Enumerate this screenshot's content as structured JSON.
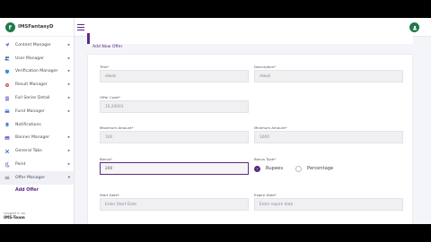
{
  "brand": {
    "name": "IMSFantasyD"
  },
  "sidebar": {
    "items": [
      {
        "label": "Content Manager",
        "icon": "paper-plane-icon",
        "arrow": "▸"
      },
      {
        "label": "User Manager",
        "icon": "users-icon",
        "arrow": "▸"
      },
      {
        "label": "Verification Manager",
        "icon": "shield-icon",
        "arrow": "▸"
      },
      {
        "label": "Result Manager",
        "icon": "gear-icon",
        "arrow": "▸"
      },
      {
        "label": "Full Series Detail",
        "icon": "document-icon",
        "arrow": "▸"
      },
      {
        "label": "Fund Manager",
        "icon": "card-icon",
        "arrow": "▸"
      },
      {
        "label": "Notifications",
        "icon": "bell-icon",
        "arrow": ""
      },
      {
        "label": "Banner Manager",
        "icon": "image-icon",
        "arrow": "▸"
      },
      {
        "label": "General Tabs",
        "icon": "cross-icon",
        "arrow": "▸"
      },
      {
        "label": "Point",
        "icon": "moon-icon",
        "arrow": "▸"
      },
      {
        "label": "Offer Manager",
        "icon": "tag-icon",
        "arrow": "▾"
      }
    ],
    "sub_item": "Add Offer",
    "logged_in_as": "Logged in as",
    "team": "IMS-Team"
  },
  "page": {
    "card_title": "Add New Offer"
  },
  "form": {
    "title": {
      "label": "Title",
      "value": "diwali"
    },
    "description": {
      "label": "Description",
      "value": "diwali"
    },
    "offer_code": {
      "label": "Offer Code",
      "value": "10,20001"
    },
    "max_amount": {
      "label": "Maximum Amount",
      "value": "100"
    },
    "min_amount": {
      "label": "Minimum Amount",
      "value": "1000"
    },
    "bonus": {
      "label": "Bonus",
      "value": "200"
    },
    "bonus_type": {
      "label": "Bonus Type",
      "options": [
        "Rupees",
        "Percentage"
      ],
      "selected": "Rupees"
    },
    "start_date": {
      "label": "Start Date",
      "placeholder": "Enter Start Date"
    },
    "expire_date": {
      "label": "Expire Date",
      "placeholder": "Enter expire date"
    }
  },
  "colors": {
    "accent": "#5b2a86",
    "brand_green": "#1f7a4a"
  }
}
